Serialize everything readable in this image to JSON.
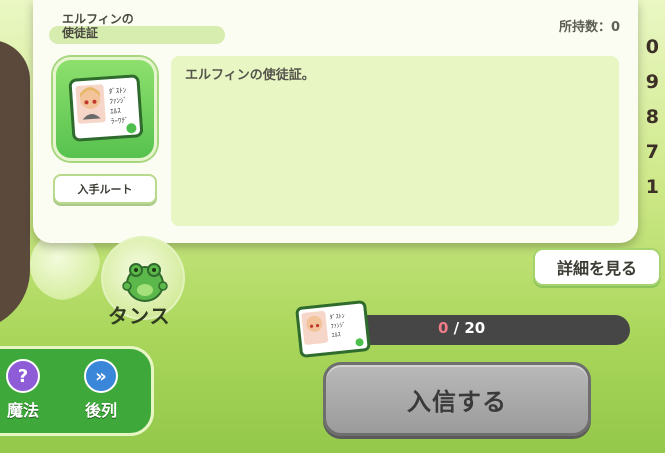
{
  "modal": {
    "title": "エルフィンの\n使徒証",
    "owned": "所持数：0",
    "description": "エルフィンの使徒証。",
    "route_button": "入手ルート"
  },
  "detail_button": "詳細を見る",
  "dance_label": "タンス",
  "progress": {
    "current": "0",
    "separator": " / ",
    "total": "20"
  },
  "enlist_button": "入信する",
  "side_buttons": [
    {
      "label": "魔法",
      "icon": "question-icon",
      "glyph": "?"
    },
    {
      "label": "後列",
      "icon": "double-chevron-right-icon",
      "glyph": "»"
    }
  ],
  "background_numbers": [
    "0",
    "9",
    "8",
    "7",
    "1"
  ],
  "colors": {
    "accent_green": "#3ea83a",
    "enlist_disabled": "#9b9b9b",
    "progress_current": "#f07c8a"
  }
}
